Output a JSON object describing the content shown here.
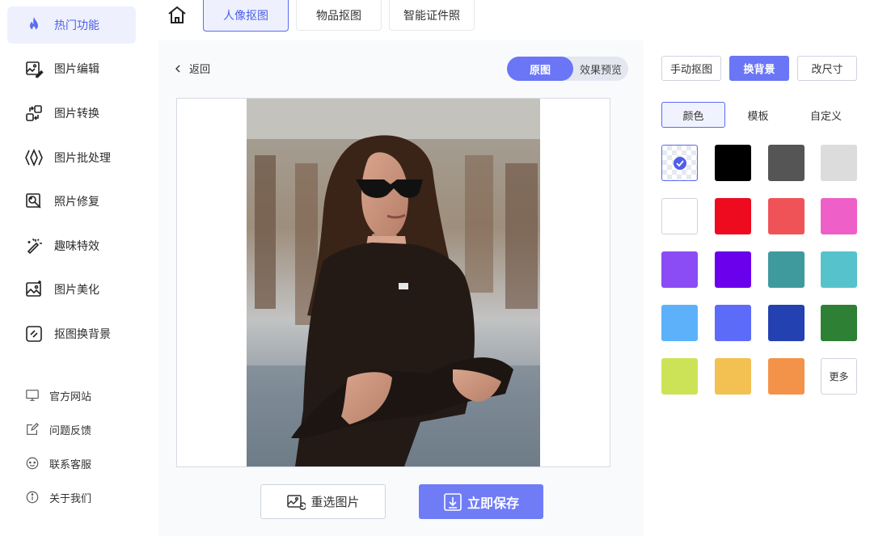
{
  "sidebar": {
    "items": [
      {
        "label": "热门功能",
        "icon": "flame-icon",
        "active": true
      },
      {
        "label": "图片编辑",
        "icon": "image-edit-icon"
      },
      {
        "label": "图片转换",
        "icon": "convert-icon"
      },
      {
        "label": "图片批处理",
        "icon": "batch-icon"
      },
      {
        "label": "照片修复",
        "icon": "repair-icon"
      },
      {
        "label": "趣味特效",
        "icon": "magic-wand-icon"
      },
      {
        "label": "图片美化",
        "icon": "beautify-icon"
      },
      {
        "label": "抠图换背景",
        "icon": "cutout-icon"
      }
    ],
    "links": [
      {
        "label": "官方网站",
        "icon": "monitor-icon"
      },
      {
        "label": "问题反馈",
        "icon": "feedback-icon"
      },
      {
        "label": "联系客服",
        "icon": "service-icon"
      },
      {
        "label": "关于我们",
        "icon": "info-icon"
      }
    ]
  },
  "topbar": {
    "tabs": [
      {
        "label": "人像抠图",
        "active": true
      },
      {
        "label": "物品抠图"
      },
      {
        "label": "智能证件照"
      }
    ]
  },
  "editor": {
    "back_label": "返回",
    "toggle_original": "原图",
    "toggle_preview": "效果预览",
    "reselect_label": "重选图片",
    "save_label": "立即保存"
  },
  "panel": {
    "tools": [
      {
        "label": "手动抠图"
      },
      {
        "label": "换背景",
        "active": true
      },
      {
        "label": "改尺寸"
      }
    ],
    "subtabs": [
      {
        "label": "颜色",
        "active": true
      },
      {
        "label": "模板"
      },
      {
        "label": "自定义"
      }
    ],
    "swatches": [
      "transparent",
      "#000000",
      "#555555",
      "#dcdcdc",
      "#ffffff",
      "#ee0b20",
      "#ef5358",
      "#ee5fc8",
      "#8b4cf6",
      "#6b00ec",
      "#3f9a9d",
      "#56c3cc",
      "#5db1fb",
      "#5d6bf9",
      "#2441b1",
      "#2e8034",
      "#cde357",
      "#f3c052",
      "#f3934a"
    ],
    "more_label": "更多"
  },
  "colors": {
    "accent": "#6a76f5",
    "active_bg": "#eef1fd"
  }
}
